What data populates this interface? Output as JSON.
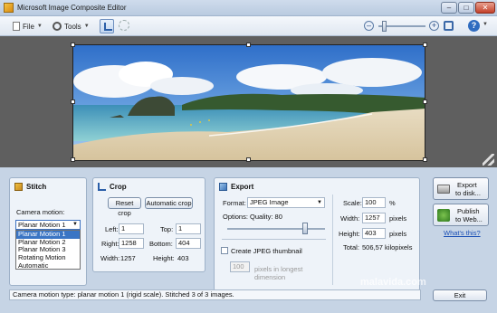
{
  "window": {
    "title": "Microsoft Image Composite Editor",
    "minimize": "–",
    "maximize": "□",
    "close": "✕"
  },
  "toolbar": {
    "file_label": "File",
    "tools_label": "Tools",
    "zoom_out": "–",
    "zoom_in": "+",
    "help": "?"
  },
  "stitch": {
    "title": "Stitch",
    "camera_motion_label": "Camera motion:",
    "selected": "Planar Motion 1",
    "options": [
      "Planar Motion 1",
      "Planar Motion 2",
      "Planar Motion 3",
      "Rotating Motion",
      "Automatic"
    ]
  },
  "crop": {
    "title": "Crop",
    "reset_label": "Reset crop",
    "auto_label": "Automatic crop",
    "left_label": "Left:",
    "left": "1",
    "top_label": "Top:",
    "top": "1",
    "right_label": "Right:",
    "right": "1258",
    "bottom_label": "Bottom:",
    "bottom": "404",
    "width_label": "Width:",
    "width": "1257",
    "height_label": "Height:",
    "height": "403"
  },
  "export": {
    "title": "Export",
    "format_label": "Format:",
    "format": "JPEG Image",
    "quality_label": "Options: Quality: 80",
    "quality_value": 80,
    "thumbnail_label": "Create JPEG thumbnail",
    "thumb_size": "100",
    "thumb_hint_1": "pixels in longest",
    "thumb_hint_2": "dimension",
    "scale_label": "Scale:",
    "scale": "100",
    "scale_unit": "%",
    "width_label": "Width:",
    "width": "1257",
    "width_unit": "pixels",
    "height_label": "Height:",
    "height": "403",
    "height_unit": "pixels",
    "total_label": "Total:",
    "total": "506,57 kilopixels"
  },
  "export_side": {
    "export_disk_1": "Export",
    "export_disk_2": "to disk...",
    "publish_1": "Publish",
    "publish_2": "to Web...",
    "whats_this": "What's this?"
  },
  "status": "Camera motion type: planar motion 1 (rigid scale). Stitched 3 of 3 images.",
  "exit_label": "Exit",
  "watermark": "malavida.com",
  "colors": {
    "accent": "#3a75c4",
    "link": "#1a4fb5"
  }
}
